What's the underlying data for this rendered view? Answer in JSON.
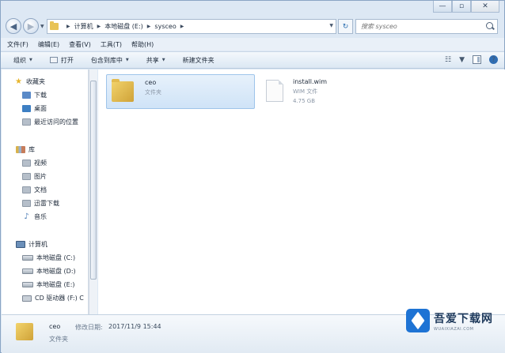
{
  "window": {
    "caption": {
      "minimize": "—",
      "maximize": "▫",
      "close": "✕"
    }
  },
  "navigation": {
    "back_glyph": "◀",
    "forward_glyph": "▶",
    "breadcrumbs": [
      "计算机",
      "本地磁盘 (E:)",
      "sysceo"
    ],
    "refresh_glyph": "↻",
    "search_placeholder": "搜索 sysceo"
  },
  "menu": [
    "文件(F)",
    "编辑(E)",
    "查看(V)",
    "工具(T)",
    "帮助(H)"
  ],
  "toolbar": {
    "organize": "组织",
    "open": "打开",
    "include_in_library": "包含到库中",
    "share": "共享",
    "new_folder": "新建文件夹"
  },
  "sidebar": {
    "favorites": "收藏夹",
    "favorites_items": [
      "下载",
      "桌面",
      "最近访问的位置"
    ],
    "libraries": "库",
    "library_items": [
      "视频",
      "图片",
      "文档",
      "迅雷下载",
      "音乐"
    ],
    "computer": "计算机",
    "computer_items": [
      "本地磁盘 (C:)",
      "本地磁盘 (D:)",
      "本地磁盘 (E:)",
      "CD 驱动器 (F:) C"
    ]
  },
  "files": [
    {
      "name": "ceo",
      "type": "文件夹",
      "meta": ""
    },
    {
      "name": "install.wim",
      "type": "WIM 文件",
      "meta": "4.75 GB"
    }
  ],
  "details": {
    "name": "ceo",
    "modified_label": "修改日期:",
    "modified_value": "2017/11/9 15:44",
    "type": "文件夹"
  },
  "watermark": {
    "title": "吾爱下载网",
    "domain": "WUAIXIAZAI.COM"
  },
  "colors": {
    "selection": "#cfe3f7",
    "folder": "#e8c356",
    "accent": "#1e73d4"
  }
}
